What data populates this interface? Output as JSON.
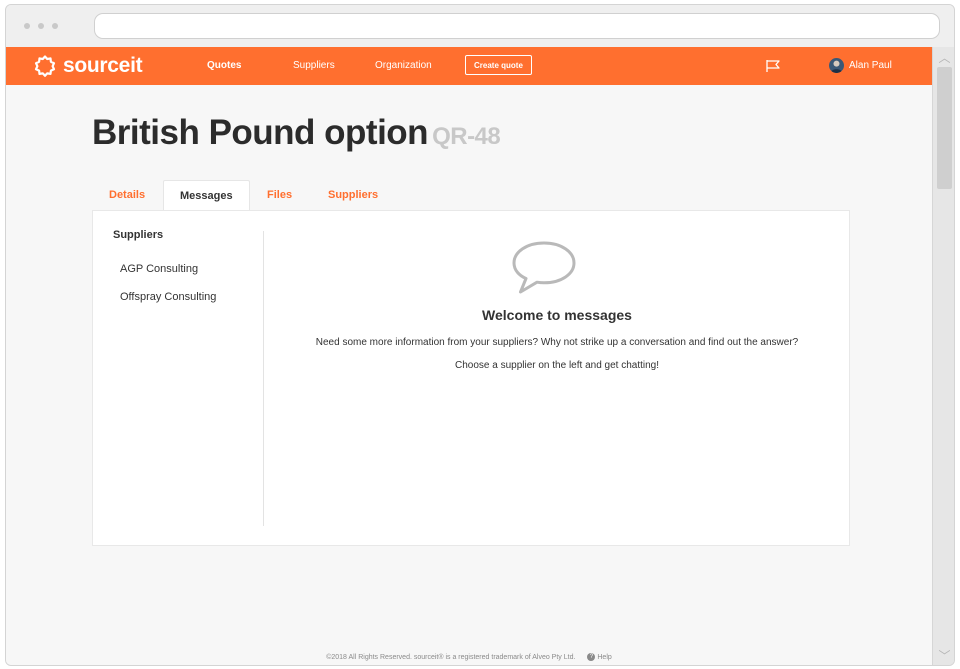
{
  "brand": {
    "name": "sourceit",
    "accent": "#ff6f2f"
  },
  "nav": {
    "links": [
      "Quotes",
      "Suppliers",
      "Organization"
    ],
    "create_quote": "Create quote",
    "user_name": "Alan Paul",
    "flag_icon": "flag-icon",
    "avatar_icon": "user-avatar"
  },
  "page": {
    "title": "British Pound option",
    "code": "QR-48"
  },
  "tabs": [
    {
      "label": "Details",
      "active": false
    },
    {
      "label": "Messages",
      "active": true
    },
    {
      "label": "Files",
      "active": false
    },
    {
      "label": "Suppliers",
      "active": false
    }
  ],
  "messages": {
    "sidebar_title": "Suppliers",
    "suppliers": [
      "AGP Consulting",
      "Offspray Consulting"
    ],
    "icon": "speech-bubble-icon",
    "welcome_title": "Welcome to messages",
    "line1": "Need some more information from your suppliers? Why not strike up a conversation and find out the answer?",
    "line2": "Choose a supplier on the left and get chatting!"
  },
  "footer": {
    "copyright": "©2018 All Rights Reserved. sourceit® is a registered trademark of Alveo Pty Ltd.",
    "help": "Help"
  }
}
